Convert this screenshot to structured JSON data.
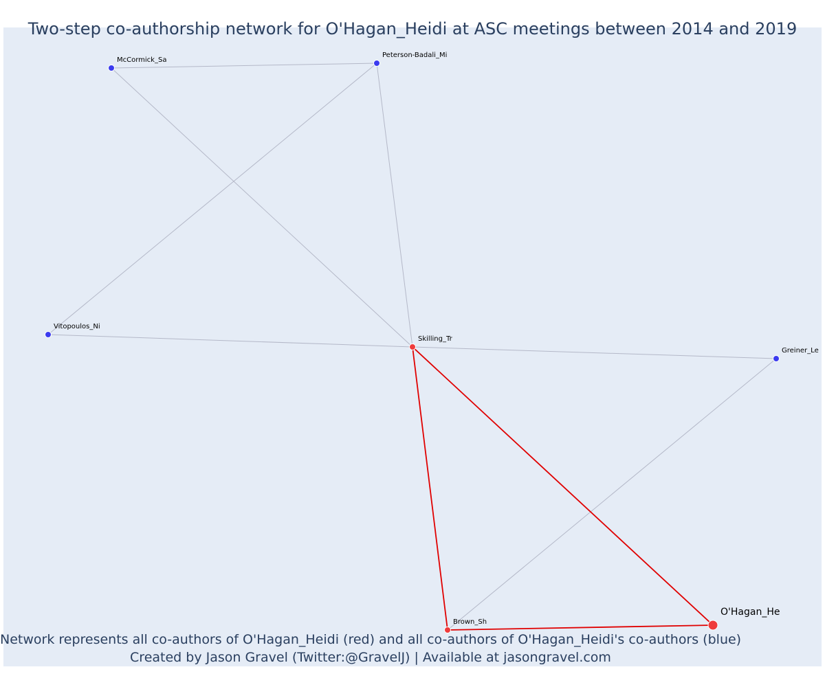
{
  "title": "Two-step co-authorship network for O'Hagan_Heidi at ASC meetings between 2014 and 2019",
  "caption": {
    "line1": "Network represents all co-authors of O'Hagan_Heidi (red) and all co-authors of O'Hagan_Heidi's co-authors (blue)",
    "line2": "Created by Jason Gravel (Twitter:@GravelJ) | Available at jasongravel.com"
  },
  "colors": {
    "background": "#e5ecf6",
    "title_text": "#2a3f5f",
    "direct_node": "#ef3b3b",
    "indirect_node": "#3b3bef",
    "direct_edge": "#e00000",
    "indirect_edge": "#b4b8c8"
  },
  "chart_data": {
    "type": "network",
    "focal_node": "O'Hagan_He",
    "nodes": [
      {
        "id": "O'Hagan_He",
        "group": "focal"
      },
      {
        "id": "Skilling_Tr",
        "group": "coauthor"
      },
      {
        "id": "Brown_Sh",
        "group": "coauthor"
      },
      {
        "id": "McCormick_Sa",
        "group": "second-step"
      },
      {
        "id": "Peterson-Badali_Mi",
        "group": "second-step"
      },
      {
        "id": "Vitopoulos_Ni",
        "group": "second-step"
      },
      {
        "id": "Greiner_Le",
        "group": "second-step"
      }
    ],
    "edges": [
      {
        "source": "O'Hagan_He",
        "target": "Skilling_Tr",
        "direct": true
      },
      {
        "source": "O'Hagan_He",
        "target": "Brown_Sh",
        "direct": true
      },
      {
        "source": "Skilling_Tr",
        "target": "Brown_Sh",
        "direct": true
      },
      {
        "source": "McCormick_Sa",
        "target": "Peterson-Badali_Mi",
        "direct": false
      },
      {
        "source": "McCormick_Sa",
        "target": "Skilling_Tr",
        "direct": false
      },
      {
        "source": "Peterson-Badali_Mi",
        "target": "Skilling_Tr",
        "direct": false
      },
      {
        "source": "Peterson-Badali_Mi",
        "target": "Vitopoulos_Ni",
        "direct": false
      },
      {
        "source": "Vitopoulos_Ni",
        "target": "Skilling_Tr",
        "direct": false
      },
      {
        "source": "Skilling_Tr",
        "target": "Greiner_Le",
        "direct": false
      },
      {
        "source": "Greiner_Le",
        "target": "Brown_Sh",
        "direct": false
      }
    ]
  }
}
